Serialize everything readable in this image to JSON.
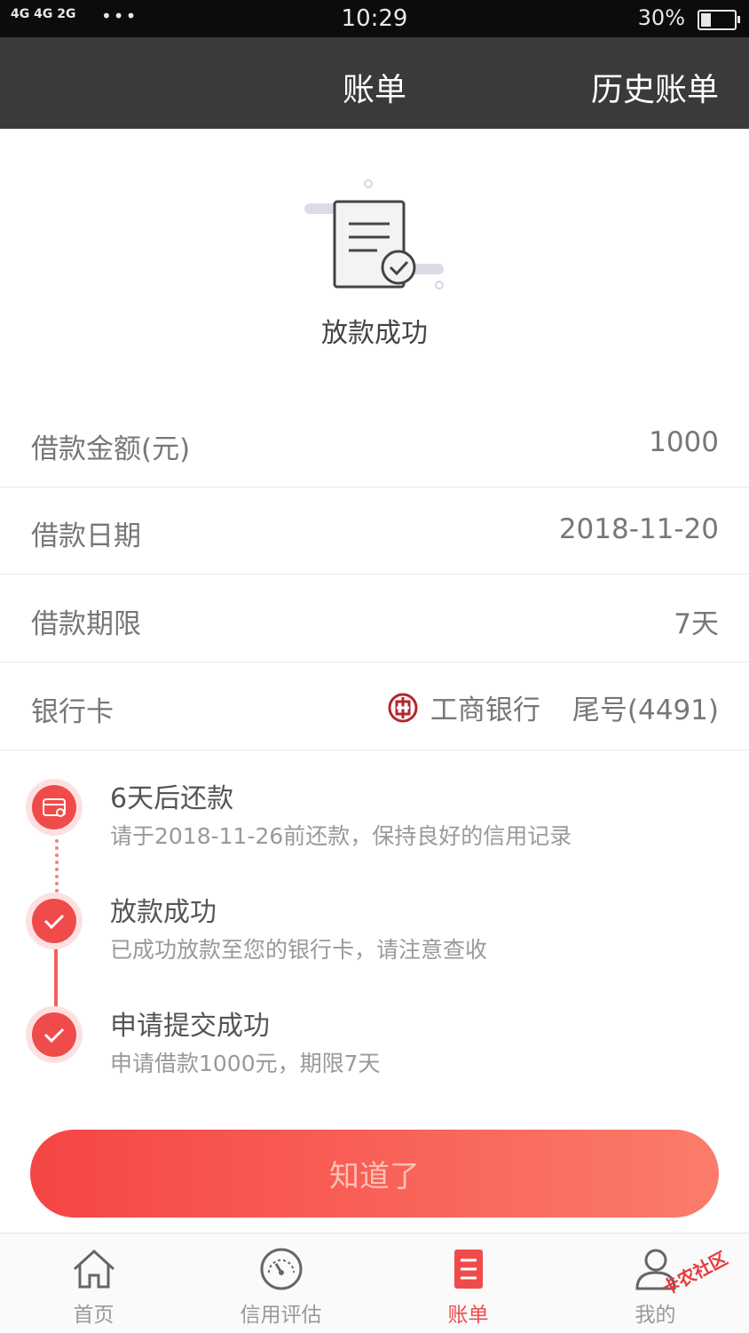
{
  "status_bar": {
    "signal": "4G 4G 2G",
    "dots": "•••",
    "time": "10:29",
    "battery": "30%"
  },
  "nav": {
    "title": "账单",
    "history": "历史账单"
  },
  "hero": {
    "status": "放款成功"
  },
  "info": {
    "amount_label": "借款金额(元)",
    "amount_value": "1000",
    "date_label": "借款日期",
    "date_value": "2018-11-20",
    "term_label": "借款期限",
    "term_value": "7天",
    "bank_label": "银行卡",
    "bank_name": "工商银行",
    "bank_tail": "尾号(4491)"
  },
  "timeline": [
    {
      "title": "6天后还款",
      "desc": "请于2018-11-26前还款，保持良好的信用记录"
    },
    {
      "title": "放款成功",
      "desc": "已成功放款至您的银行卡，请注意查收"
    },
    {
      "title": "申请提交成功",
      "desc": "申请借款1000元，期限7天"
    }
  ],
  "confirm_button": "知道了",
  "tabs": [
    {
      "label": "首页",
      "icon": "home-icon"
    },
    {
      "label": "信用评估",
      "icon": "gauge-icon"
    },
    {
      "label": "账单",
      "icon": "bill-icon",
      "active": true
    },
    {
      "label": "我的",
      "icon": "user-icon"
    }
  ],
  "watermark": "卡农社区",
  "colors": {
    "accent": "#f04b4b",
    "nav_bg": "#3a3a3a",
    "status_bg": "#0c0c0c"
  }
}
